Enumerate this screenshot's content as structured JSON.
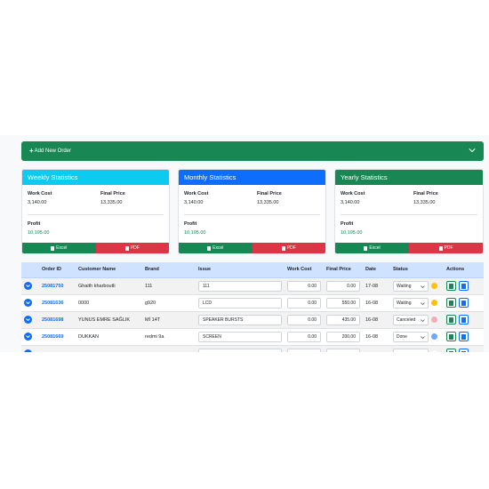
{
  "add_order": {
    "label": "Add New Order",
    "plus": "+"
  },
  "cards": {
    "weekly": {
      "title": "Weekly Statistics",
      "work_cost_label": "Work Cost",
      "work_cost": "3,140.00",
      "final_price_label": "Final Price",
      "final_price": "13,335.00",
      "profit_label": "Profit",
      "profit": "10,195.00",
      "excel_label": "Excel",
      "pdf_label": "PDF"
    },
    "monthly": {
      "title": "Monthly Statistics",
      "work_cost_label": "Work Cost",
      "work_cost": "3,140.00",
      "final_price_label": "Final Price",
      "final_price": "13,335.00",
      "profit_label": "Profit",
      "profit": "10,195.00",
      "excel_label": "Excel",
      "pdf_label": "PDF"
    },
    "yearly": {
      "title": "Yearly Statistics",
      "work_cost_label": "Work Cost",
      "work_cost": "3,140.00",
      "final_price_label": "Final Price",
      "final_price": "13,335.00",
      "profit_label": "Profit",
      "profit": "10,195.00",
      "excel_label": "Excel",
      "pdf_label": "PDF"
    }
  },
  "table": {
    "headers": [
      "",
      "Order ID",
      "Customer Name",
      "Brand",
      "Issue",
      "Work Cost",
      "Final Price",
      "Date",
      "Status",
      "Actions"
    ],
    "rows": [
      {
        "order_id": "25081750",
        "customer": "Ghaith kharboutli",
        "brand": "111",
        "issue": "111",
        "work_cost": "0.00",
        "final_price": "0.00",
        "date": "17-08",
        "status": "Waiting",
        "status_color": "#ffc107"
      },
      {
        "order_id": "25081636",
        "customer": "0000",
        "brand": "g920",
        "issue": "LCD",
        "work_cost": "0.00",
        "final_price": "550.00",
        "date": "16-08",
        "status": "Waiting",
        "status_color": "#ffc107"
      },
      {
        "order_id": "25081698",
        "customer": "YUNUS EMRE SAĞLIK",
        "brand": "Mİ 14T",
        "issue": "SPEAKER BURSTS",
        "work_cost": "0.00",
        "final_price": "435.00",
        "date": "16-08",
        "status": "Canceled",
        "status_color": "#f1aeb5"
      },
      {
        "order_id": "25081669",
        "customer": "DUKKAN",
        "brand": "redmi 9a",
        "issue": "SCREEN",
        "work_cost": "0.00",
        "final_price": "200.00",
        "date": "16-08",
        "status": "Done",
        "status_color": "#6ea8fe"
      },
      {
        "order_id": "",
        "customer": "",
        "brand": "",
        "issue": "",
        "work_cost": "",
        "final_price": "",
        "date": "",
        "status": "",
        "status_color": "#ffffff"
      }
    ]
  },
  "colors": {
    "primary": "#0d6efd",
    "success": "#198754",
    "info": "#0dcaf0",
    "danger": "#dc3545",
    "table_header": "#cfe2ff"
  }
}
